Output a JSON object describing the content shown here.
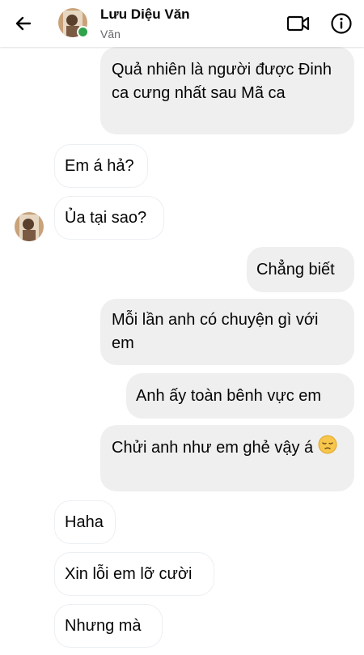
{
  "header": {
    "contact_name": "Lưu Diệu Văn",
    "contact_subtitle": "Văn",
    "online": true
  },
  "icons": [
    "back-arrow-icon",
    "video-call-icon",
    "info-icon",
    "pensive-face-emoji"
  ],
  "colors": {
    "outgoing_bubble": "#efefef",
    "incoming_bubble": "#ffffff",
    "online_dot": "#31a24c"
  },
  "messages": [
    {
      "direction": "outgoing",
      "text": "Quả nhiên là người được Đinh ca cưng nhất sau Mã ca"
    },
    {
      "direction": "incoming",
      "text": "Em á hả?"
    },
    {
      "direction": "incoming",
      "text": "Ủa tại sao?"
    },
    {
      "direction": "outgoing",
      "text": "Chẳng biết"
    },
    {
      "direction": "outgoing",
      "text": "Mỗi lần anh có chuyện gì với em"
    },
    {
      "direction": "outgoing",
      "text": "Anh ấy toàn bênh vực em"
    },
    {
      "direction": "outgoing",
      "text": "Chửi anh như em ghẻ vậy á",
      "emoji": "pensive-face"
    },
    {
      "direction": "incoming",
      "text": "Haha"
    },
    {
      "direction": "incoming",
      "text": "Xin lỗi em lỡ cười"
    },
    {
      "direction": "incoming",
      "text": "Nhưng mà"
    }
  ]
}
